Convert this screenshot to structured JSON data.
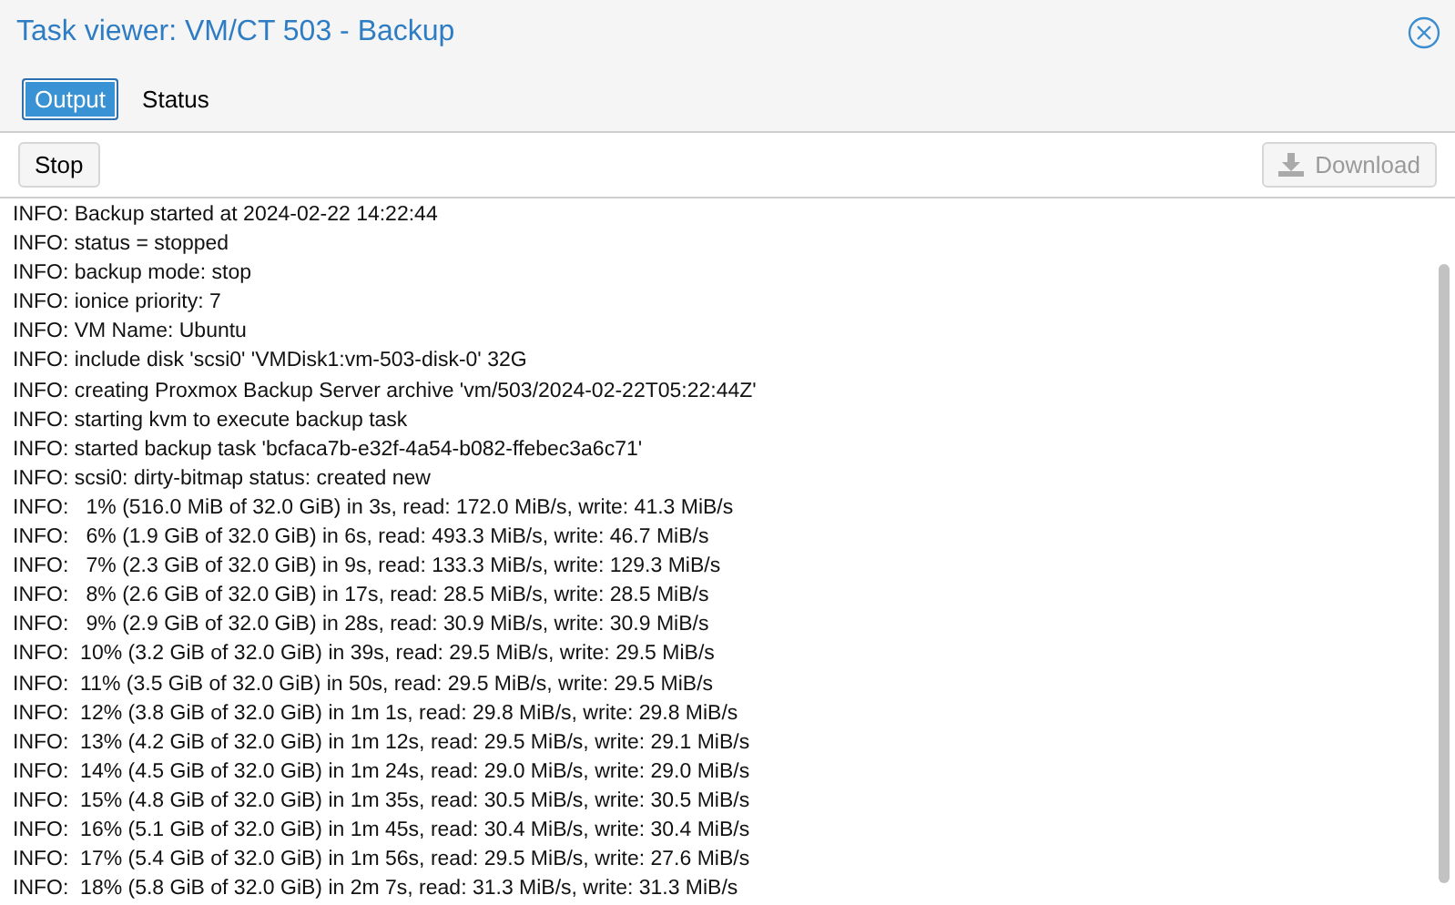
{
  "window": {
    "title": "Task viewer: VM/CT 503 - Backup"
  },
  "tabs": [
    {
      "label": "Output",
      "selected": true
    },
    {
      "label": "Status",
      "selected": false
    }
  ],
  "toolbar": {
    "buttons": [
      {
        "label": "Stop",
        "disabled": false,
        "kind": "plain"
      },
      {
        "label": "Download",
        "disabled": true,
        "kind": "download"
      }
    ]
  },
  "log": [
    "INFO: Backup started at 2024-02-22 14:22:44",
    "INFO: status = stopped",
    "INFO: backup mode: stop",
    "INFO: ionice priority: 7",
    "INFO: VM Name: Ubuntu",
    "INFO: include disk 'scsi0' 'VMDisk1:vm-503-disk-0' 32G",
    "INFO: creating Proxmox Backup Server archive 'vm/503/2024-02-22T05:22:44Z'",
    "INFO: starting kvm to execute backup task",
    "INFO: started backup task 'bcfaca7b-e32f-4a54-b082-ffebec3a6c71'",
    "INFO: scsi0: dirty-bitmap status: created new",
    "INFO:   1% (516.0 MiB of 32.0 GiB) in 3s, read: 172.0 MiB/s, write: 41.3 MiB/s",
    "INFO:   6% (1.9 GiB of 32.0 GiB) in 6s, read: 493.3 MiB/s, write: 46.7 MiB/s",
    "INFO:   7% (2.3 GiB of 32.0 GiB) in 9s, read: 133.3 MiB/s, write: 129.3 MiB/s",
    "INFO:   8% (2.6 GiB of 32.0 GiB) in 17s, read: 28.5 MiB/s, write: 28.5 MiB/s",
    "INFO:   9% (2.9 GiB of 32.0 GiB) in 28s, read: 30.9 MiB/s, write: 30.9 MiB/s",
    "INFO:  10% (3.2 GiB of 32.0 GiB) in 39s, read: 29.5 MiB/s, write: 29.5 MiB/s",
    "INFO:  11% (3.5 GiB of 32.0 GiB) in 50s, read: 29.5 MiB/s, write: 29.5 MiB/s",
    "INFO:  12% (3.8 GiB of 32.0 GiB) in 1m 1s, read: 29.8 MiB/s, write: 29.8 MiB/s",
    "INFO:  13% (4.2 GiB of 32.0 GiB) in 1m 12s, read: 29.5 MiB/s, write: 29.1 MiB/s",
    "INFO:  14% (4.5 GiB of 32.0 GiB) in 1m 24s, read: 29.0 MiB/s, write: 29.0 MiB/s",
    "INFO:  15% (4.8 GiB of 32.0 GiB) in 1m 35s, read: 30.5 MiB/s, write: 30.5 MiB/s",
    "INFO:  16% (5.1 GiB of 32.0 GiB) in 1m 45s, read: 30.4 MiB/s, write: 30.4 MiB/s",
    "INFO:  17% (5.4 GiB of 32.0 GiB) in 1m 56s, read: 29.5 MiB/s, write: 27.6 MiB/s",
    "INFO:  18% (5.8 GiB of 32.0 GiB) in 2m 7s, read: 31.3 MiB/s, write: 31.3 MiB/s"
  ]
}
